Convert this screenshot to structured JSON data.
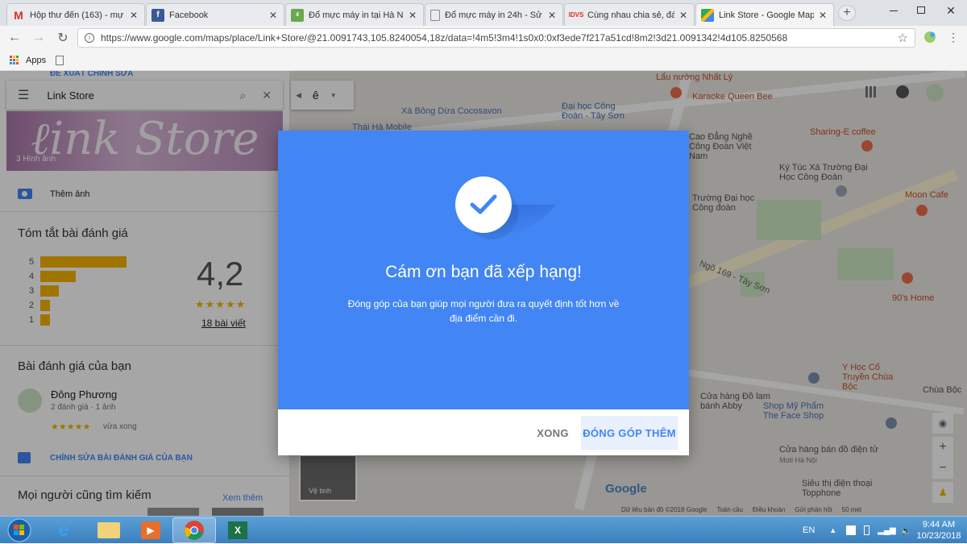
{
  "browser": {
    "tabs": [
      {
        "title": "Hộp thư đến (163) - mự",
        "icon": "gmail-icon",
        "active": false
      },
      {
        "title": "Facebook",
        "icon": "facebook-icon",
        "active": false
      },
      {
        "title": "Đổ mực máy in tại Hà N",
        "icon": "site-icon",
        "active": false
      },
      {
        "title": "Đổ mực máy in 24h - Sử",
        "icon": "page-icon",
        "active": false
      },
      {
        "title": "Cùng nhau chia sẻ, đánh",
        "icon": "site-icon",
        "active": false
      },
      {
        "title": "Link Store - Google Map",
        "icon": "maps-icon",
        "active": true
      }
    ],
    "url": "https://www.google.com/maps/place/Link+Store/@21.0091743,105.8240054,18z/data=!4m5!3m4!1s0x0:0xf3ede7f217a51cd!8m2!3d21.0091342!4d105.8250568",
    "bookmarks": {
      "apps_label": "Apps"
    }
  },
  "panel": {
    "top_link": "ĐỀ XUẤT CHỈNH SỬA",
    "search_value": "Link Store",
    "photo_caption": "3 Hình ảnh",
    "add_photo": "Thêm ảnh",
    "summary_title": "Tóm tắt bài đánh giá",
    "rating_rows": [
      {
        "star": "5",
        "fraction": 0.82
      },
      {
        "star": "4",
        "fraction": 0.34
      },
      {
        "star": "3",
        "fraction": 0.18
      },
      {
        "star": "2",
        "fraction": 0.09
      },
      {
        "star": "1",
        "fraction": 0.09
      }
    ],
    "rating_value": "4,2",
    "rating_stars": "★★★★★",
    "review_count": "18 bài viết",
    "your_review_title": "Bài đánh giá của bạn",
    "reviewer_name": "Đông Phương",
    "reviewer_meta": "2 đánh giá · 1 ảnh",
    "reviewer_stars": "★★★★★",
    "reviewer_time": "vừa xong",
    "edit_review": "CHỈNH SỬA BÀI ĐÁNH GIÁ CỦA BẠN",
    "people_search": "Mọi người cũng tìm kiếm",
    "see_more": "Xem thêm"
  },
  "map": {
    "labels": [
      {
        "text": "Lẩu nướng Nhất Lý",
        "color": "#c5502a"
      },
      {
        "text": "Karaoke Queen Bee",
        "color": "#c5502a"
      },
      {
        "text": "Xà Bông Dừa Cocosavon",
        "color": "#4a72b8"
      },
      {
        "text": "Đại học Công Đoàn - Tây Sơn",
        "color": "#4a72b8"
      },
      {
        "text": "Sharing-E coffee",
        "color": "#c5502a"
      },
      {
        "text": "Cao Đẳng Nghề Công Đoàn Việt Nam",
        "color": "#555555"
      },
      {
        "text": "Ký Túc Xá Trường Đại Học Công Đoàn",
        "color": "#555555"
      },
      {
        "text": "Moon Cafe",
        "color": "#c5502a"
      },
      {
        "text": "Trường Đại học Công đoàn",
        "color": "#555555"
      },
      {
        "text": "Ngõ 169 - Tây Sơn",
        "color": "#666666"
      },
      {
        "text": "90's Home",
        "color": "#c5502a"
      },
      {
        "text": "Y Học Cổ Truyền Chùa Bộc",
        "color": "#c5502a"
      },
      {
        "text": "Chùa Bộc",
        "color": "#555555"
      },
      {
        "text": "Cửa hàng Đồ lam bánh Abby",
        "color": "#555555"
      },
      {
        "text": "Shop Mỹ Phẩm The Face Shop",
        "color": "#4a72b8"
      },
      {
        "text": "Cửa hàng bán đồ điện tử",
        "color": "#555555"
      },
      {
        "text": "Siêu thị điện thoại Topphone",
        "color": "#555555"
      },
      {
        "text": "Thái Hà Mobile",
        "color": "#4a72b8"
      },
      {
        "text": "Moti Hà Nội",
        "color": "#777777"
      }
    ],
    "satellite_label": "Vệ tinh",
    "footer": [
      "Dữ liệu bản đồ ©2018 Google",
      "Toàn cầu",
      "Điều khoản",
      "Gửi phản hồi",
      "50 mét"
    ],
    "google_logo": "Google",
    "layer_label": "ê"
  },
  "dialog": {
    "title": "Cám ơn bạn đã xếp hạng!",
    "subtitle": "Đóng góp của bạn giúp mọi người đưa ra quyết định tốt hơn về địa điểm cần đi.",
    "done_label": "XONG",
    "more_label": "ĐÓNG GÓP THÊM",
    "accent": "#4285f4"
  },
  "taskbar": {
    "lang": "EN",
    "time": "9:44 AM",
    "date": "10/23/2018"
  }
}
